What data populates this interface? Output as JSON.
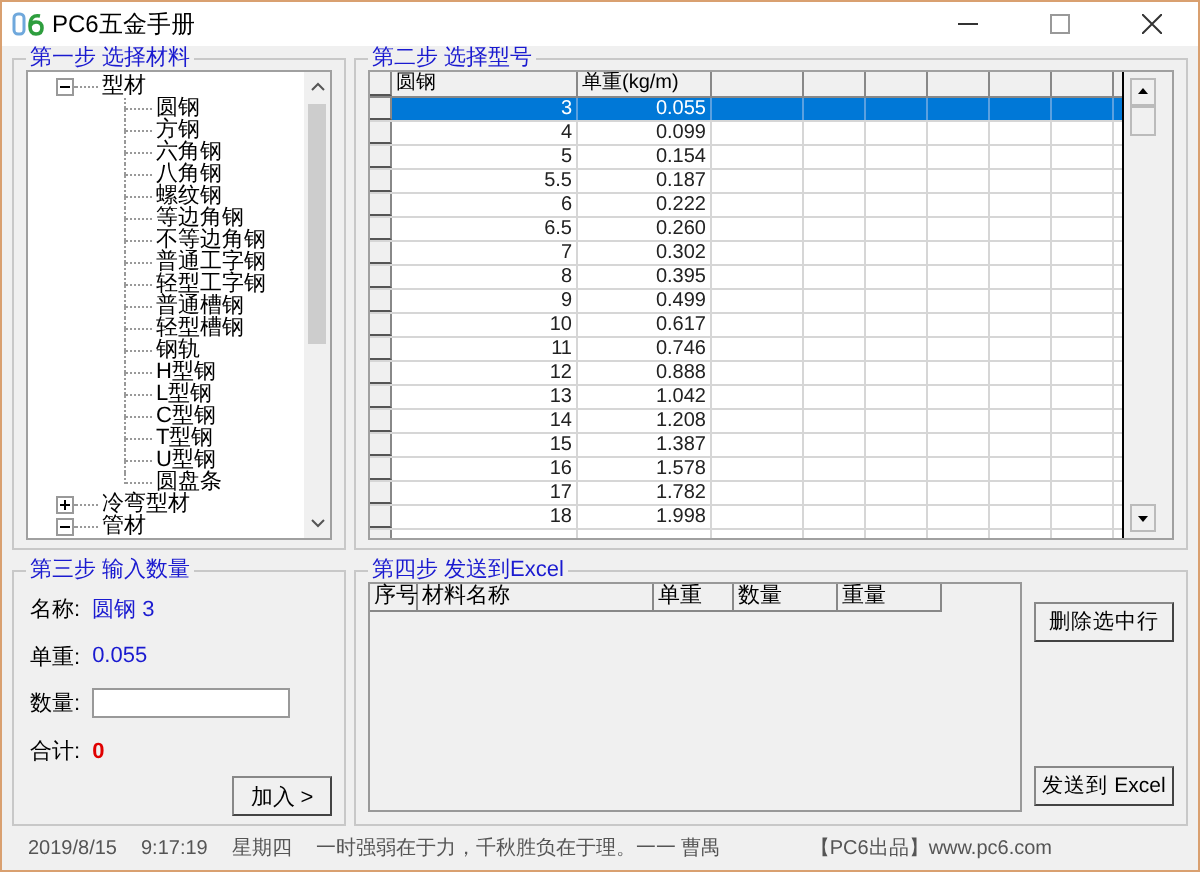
{
  "window": {
    "title": "PC6五金手册"
  },
  "step1": {
    "title": "第一步 选择材料",
    "tree": [
      {
        "label": "型材",
        "expanded": true,
        "children": [
          {
            "label": "圆钢"
          },
          {
            "label": "方钢"
          },
          {
            "label": "六角钢"
          },
          {
            "label": "八角钢"
          },
          {
            "label": "螺纹钢"
          },
          {
            "label": "等边角钢"
          },
          {
            "label": "不等边角钢"
          },
          {
            "label": "普通工字钢"
          },
          {
            "label": "轻型工字钢"
          },
          {
            "label": "普通槽钢"
          },
          {
            "label": "轻型槽钢"
          },
          {
            "label": "钢轨"
          },
          {
            "label": "H型钢"
          },
          {
            "label": "L型钢"
          },
          {
            "label": "C型钢"
          },
          {
            "label": "T型钢"
          },
          {
            "label": "U型钢"
          },
          {
            "label": "圆盘条"
          }
        ]
      },
      {
        "label": "冷弯型材",
        "expanded": false
      },
      {
        "label": "管材",
        "expanded": true
      }
    ]
  },
  "step2": {
    "title": "第二步 选择型号",
    "columns": [
      "圆钢",
      "单重(kg/m)"
    ],
    "rows": [
      {
        "size": "3",
        "weight": "0.055",
        "selected": true
      },
      {
        "size": "4",
        "weight": "0.099",
        "selected": false
      },
      {
        "size": "5",
        "weight": "0.154",
        "selected": false
      },
      {
        "size": "5.5",
        "weight": "0.187",
        "selected": false
      },
      {
        "size": "6",
        "weight": "0.222",
        "selected": false
      },
      {
        "size": "6.5",
        "weight": "0.260",
        "selected": false
      },
      {
        "size": "7",
        "weight": "0.302",
        "selected": false
      },
      {
        "size": "8",
        "weight": "0.395",
        "selected": false
      },
      {
        "size": "9",
        "weight": "0.499",
        "selected": false
      },
      {
        "size": "10",
        "weight": "0.617",
        "selected": false
      },
      {
        "size": "11",
        "weight": "0.746",
        "selected": false
      },
      {
        "size": "12",
        "weight": "0.888",
        "selected": false
      },
      {
        "size": "13",
        "weight": "1.042",
        "selected": false
      },
      {
        "size": "14",
        "weight": "1.208",
        "selected": false
      },
      {
        "size": "15",
        "weight": "1.387",
        "selected": false
      },
      {
        "size": "16",
        "weight": "1.578",
        "selected": false
      },
      {
        "size": "17",
        "weight": "1.782",
        "selected": false
      },
      {
        "size": "18",
        "weight": "1.998",
        "selected": false
      }
    ]
  },
  "step3": {
    "title": "第三步 输入数量",
    "name_label": "名称:",
    "name_value": "圆钢 3",
    "weight_label": "单重:",
    "weight_value": "0.055",
    "qty_label": "数量:",
    "total_label": "合计:",
    "total_value": "0",
    "add_button": "加入 >"
  },
  "step4": {
    "title": "第四步 发送到Excel",
    "columns": [
      "序号",
      "材料名称",
      "单重",
      "数量",
      "重量"
    ],
    "delete_button": "删除选中行",
    "send_button": "发送到 Excel"
  },
  "status_bar": {
    "date": "2019/8/15",
    "time": "9:17:19",
    "weekday": "星期四",
    "quote": "一时强弱在于力，千秋胜负在于理。一一 曹禺",
    "credit": "【PC6出品】www.pc6.com"
  }
}
